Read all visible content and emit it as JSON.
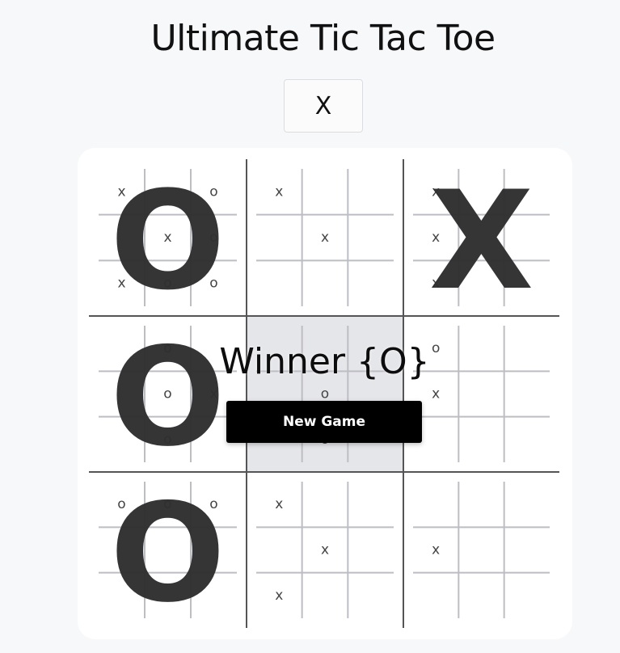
{
  "title": "Ultimate Tic Tac Toe",
  "current_player": "X",
  "winner_message": "Winner {O}",
  "new_game_label": "New Game",
  "active_board": 4,
  "boards": [
    {
      "winner": "O",
      "cells": [
        "X",
        "",
        "O",
        "",
        "X",
        "O",
        "X",
        "O",
        "O"
      ]
    },
    {
      "winner": "",
      "cells": [
        "X",
        "",
        "",
        "",
        "X",
        "",
        "",
        "",
        ""
      ]
    },
    {
      "winner": "X",
      "cells": [
        "X",
        "",
        "",
        "X",
        "",
        "",
        "X",
        "",
        ""
      ]
    },
    {
      "winner": "O",
      "cells": [
        "",
        "O",
        "",
        "",
        "O",
        "X",
        "",
        "O",
        ""
      ]
    },
    {
      "winner": "",
      "cells": [
        "",
        "",
        "",
        "",
        "O",
        "",
        "",
        "O",
        ""
      ]
    },
    {
      "winner": "",
      "cells": [
        "O",
        "",
        "",
        "X",
        "",
        "",
        "",
        "",
        ""
      ]
    },
    {
      "winner": "O",
      "cells": [
        "O",
        "O",
        "O",
        "",
        "",
        "",
        "",
        "",
        ""
      ]
    },
    {
      "winner": "",
      "cells": [
        "X",
        "",
        "",
        "",
        "X",
        "",
        "X",
        "",
        ""
      ]
    },
    {
      "winner": "",
      "cells": [
        "",
        "",
        "",
        "X",
        "",
        "",
        "",
        "",
        ""
      ]
    }
  ],
  "colors": {
    "background": "#f7f8fa",
    "board": "#ffffff",
    "button": "#000000",
    "active": "#e5e6ea"
  }
}
